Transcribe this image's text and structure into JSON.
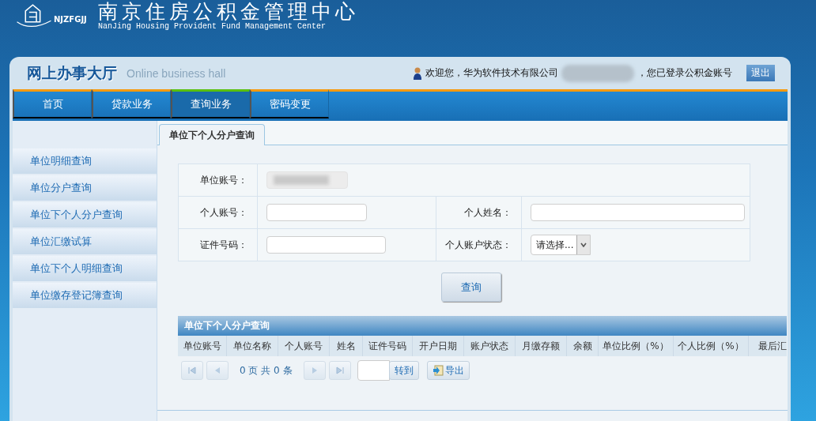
{
  "header": {
    "logo_text": "NJZFGJJ",
    "title": "南京住房公积金管理中心",
    "subtitle": "NanJing Housing Provident Fund Management Center"
  },
  "hall": {
    "title": "网上办事大厅",
    "subtitle": "Online business hall"
  },
  "user": {
    "welcome": "欢迎您，华为软件技术有限公司",
    "logged_in": "，您已登录公积金账号",
    "logout": "退出"
  },
  "nav": [
    {
      "label": "首页",
      "selected": false
    },
    {
      "label": "贷款业务",
      "selected": false
    },
    {
      "label": "查询业务",
      "selected": true
    },
    {
      "label": "密码变更",
      "selected": false
    }
  ],
  "sidebar": {
    "items": [
      {
        "label": "单位明细查询",
        "selected": false
      },
      {
        "label": "单位分户查询",
        "selected": false
      },
      {
        "label": "单位下个人分户查询",
        "selected": false
      },
      {
        "label": "单位汇缴试算",
        "selected": false
      },
      {
        "label": "单位下个人明细查询",
        "selected": false
      },
      {
        "label": "单位缴存登记簿查询",
        "selected": false
      }
    ]
  },
  "tabs": [
    {
      "label": "单位下个人分户查询",
      "selected": true
    }
  ],
  "form": {
    "unit_account_label": "单位账号：",
    "personal_account_label": "个人账号：",
    "name_label": "个人姓名：",
    "id_label": "证件号码：",
    "status_label": "个人账户状态：",
    "status_value": "请选择...",
    "query_button": "查询"
  },
  "table": {
    "title": "单位下个人分户查询",
    "columns": [
      "单位账号",
      "单位名称",
      "个人账号",
      "姓名",
      "证件号码",
      "开户日期",
      "账户状态",
      "月缴存额",
      "余额",
      "单位比例（%）",
      "个人比例（%）",
      "最后汇"
    ]
  },
  "pager": {
    "info": "0 页 共 0 条",
    "goto": "转到",
    "export": "导出"
  }
}
